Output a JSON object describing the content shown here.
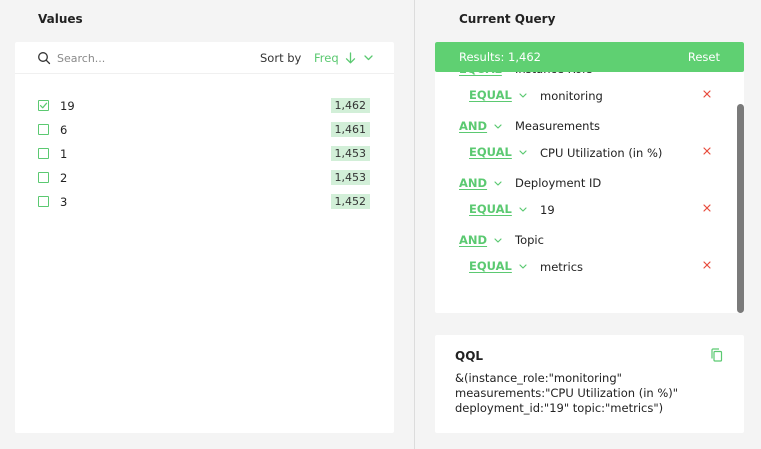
{
  "values_panel": {
    "title": "Values",
    "search": {
      "placeholder": "Search...",
      "value": ""
    },
    "sort_label": "Sort by",
    "sort_value": "Freq",
    "items": [
      {
        "label": "19",
        "count": "1,462",
        "checked": true
      },
      {
        "label": "6",
        "count": "1,461",
        "checked": false
      },
      {
        "label": "1",
        "count": "1,453",
        "checked": false
      },
      {
        "label": "2",
        "count": "1,453",
        "checked": false
      },
      {
        "label": "3",
        "count": "1,452",
        "checked": false
      }
    ]
  },
  "query_panel": {
    "title": "Current Query",
    "results_text": "Results: 1,462",
    "reset_label": "Reset",
    "clauses": [
      {
        "logic": "EQUAL",
        "field": "Instance Role",
        "match": "EQUAL",
        "value": "monitoring"
      },
      {
        "logic": "AND",
        "field": "Measurements",
        "match": "EQUAL",
        "value": "CPU Utilization (in %)"
      },
      {
        "logic": "AND",
        "field": "Deployment ID",
        "match": "EQUAL",
        "value": "19"
      },
      {
        "logic": "AND",
        "field": "Topic",
        "match": "EQUAL",
        "value": "metrics"
      }
    ]
  },
  "qql_panel": {
    "title": "QQL",
    "lines": [
      "&(instance_role:\"monitoring\"",
      "measurements:\"CPU Utilization (in %)\"",
      "deployment_id:\"19\" topic:\"metrics\")"
    ]
  },
  "colors": {
    "accent": "#5bc971",
    "results_bar": "#5fd072",
    "count_badge": "#d2efd8",
    "remove": "#e84c3d",
    "panel_bg": "#f4f4f4",
    "card_bg": "#ffffff"
  },
  "icons": {
    "search": "search-icon",
    "sort_direction": "arrow-down-icon",
    "dropdown": "chevron-down-icon",
    "check": "check-icon",
    "remove": "close-icon",
    "copy": "copy-icon"
  }
}
